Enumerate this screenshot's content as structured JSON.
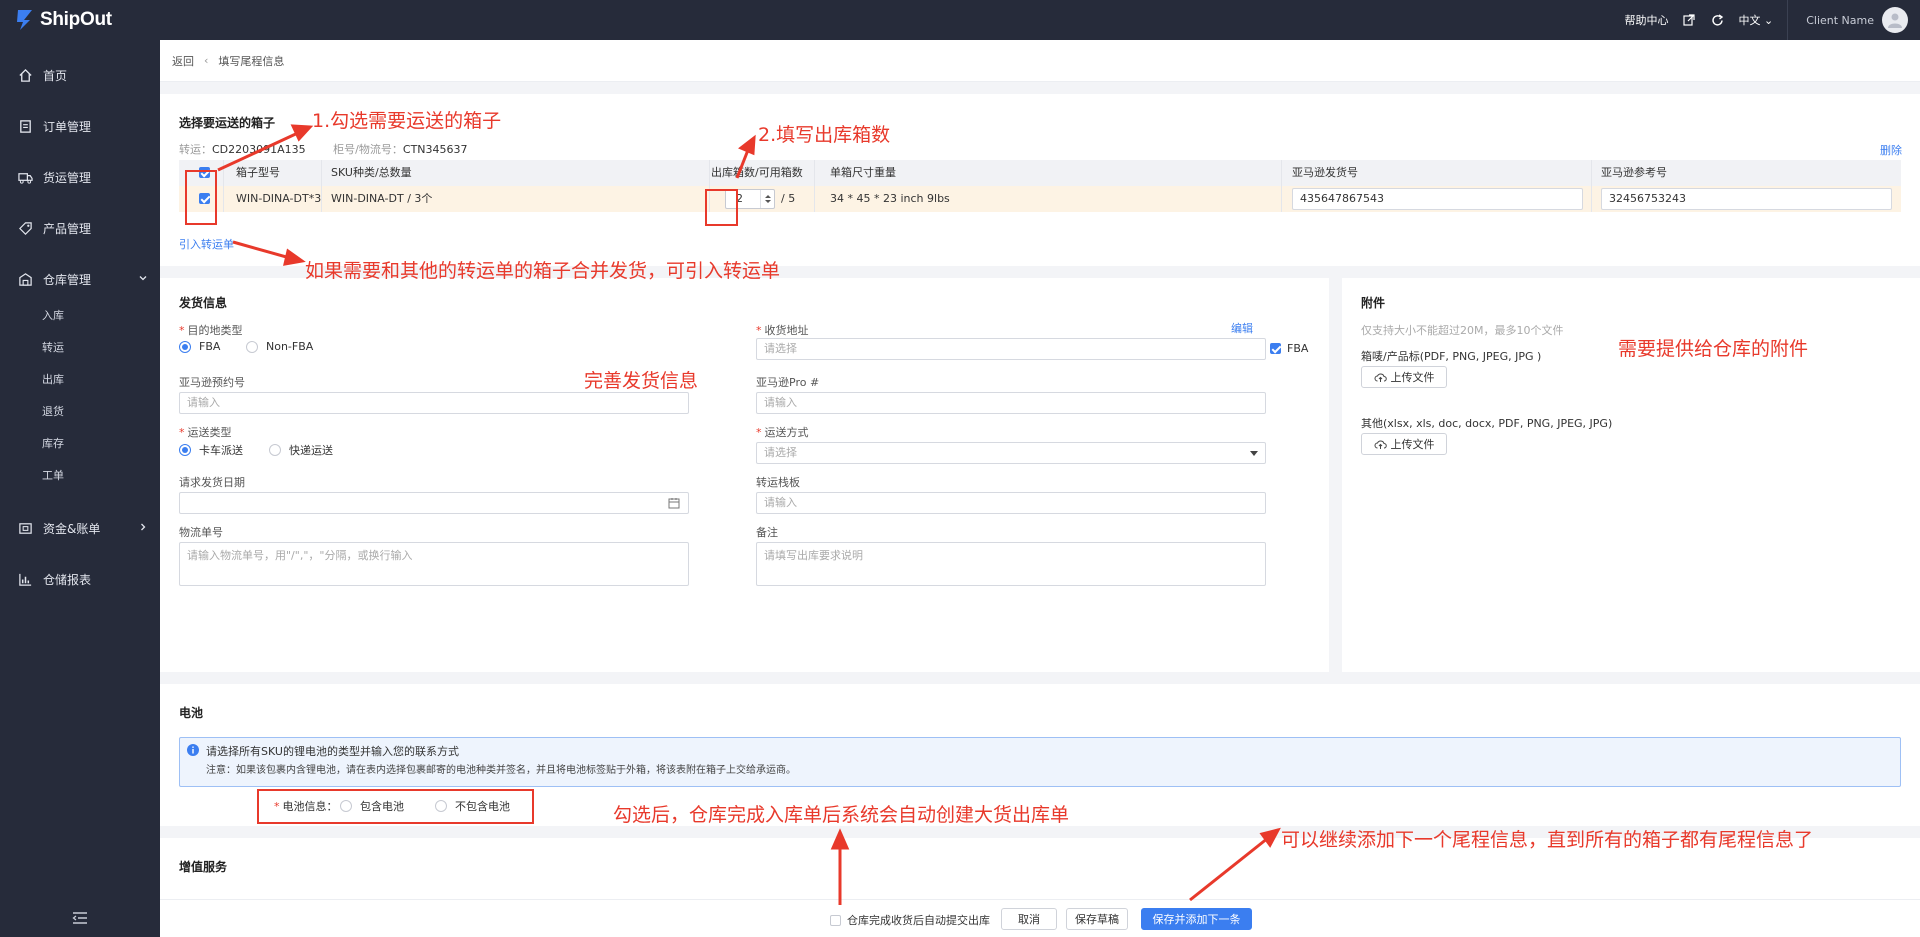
{
  "header": {
    "brand": "ShipOut",
    "help_center": "帮助中心",
    "language": "中文",
    "client_name": "Client Name"
  },
  "sidebar": {
    "items": [
      {
        "label": "首页",
        "icon": "home-icon"
      },
      {
        "label": "订单管理",
        "icon": "order-icon"
      },
      {
        "label": "货运管理",
        "icon": "truck-icon"
      },
      {
        "label": "产品管理",
        "icon": "tag-icon"
      },
      {
        "label": "仓库管理",
        "icon": "warehouse-icon"
      },
      {
        "label": "资金&账单",
        "icon": "finance-icon"
      },
      {
        "label": "仓储报表",
        "icon": "report-icon"
      }
    ],
    "warehouse_sub": [
      "入库",
      "转运",
      "出库",
      "退货",
      "库存",
      "工单"
    ]
  },
  "breadcrumb": {
    "back": "返回",
    "current": "填写尾程信息"
  },
  "boxes": {
    "title": "选择要运送的箱子",
    "transfer_label": "转运：",
    "transfer_value": "CD2203091A135",
    "container_label": "柜号/物流号：",
    "container_value": "CTN345637",
    "delete": "删除",
    "import": "引入转运单",
    "columns": [
      "箱子型号",
      "SKU种类/总数量",
      "出库箱数/可用箱数",
      "单箱尺寸重量",
      "亚马逊发货号",
      "亚马逊参考号"
    ],
    "row": {
      "box_type": "WIN-DINA-DT*3",
      "sku": "WIN-DINA-DT / 3个",
      "out_qty": "2",
      "available": "/ 5",
      "size": "34 * 45 * 23 inch 9lbs",
      "shipment_id": "435647867543",
      "ref_id": "32456753243"
    }
  },
  "shipping": {
    "title": "发货信息",
    "dest_type_label": "目的地类型",
    "dest_options": [
      "FBA",
      "Non-FBA"
    ],
    "address_label": "收货地址",
    "edit": "编辑",
    "address_placeholder": "请选择",
    "fba_check": "FBA",
    "appt_label": "亚马逊预约号",
    "appt_placeholder": "请输入",
    "pro_label": "亚马逊Pro #",
    "pro_placeholder": "请输入",
    "ship_type_label": "运送类型",
    "ship_type_options": [
      "卡车派送",
      "快递运送"
    ],
    "ship_method_label": "运送方式",
    "ship_method_placeholder": "请选择",
    "date_label": "请求发货日期",
    "pallet_label": "转运栈板",
    "pallet_placeholder": "请输入",
    "tracking_label": "物流单号",
    "tracking_placeholder": "请输入物流单号，用\"/\",\"，\"分隔，或换行输入",
    "remark_label": "备注",
    "remark_placeholder": "请填写出库要求说明"
  },
  "attachments": {
    "title": "附件",
    "hint": "仅支持大小不能超过20M，最多10个文件",
    "label1": "箱唛/产品标(PDF, PNG, JPEG, JPG )",
    "label2": "其他(xlsx, xls, doc, docx, PDF, PNG, JPEG, JPG)",
    "upload": "上传文件"
  },
  "battery": {
    "title": "电池",
    "notice1": "请选择所有SKU的锂电池的类型并输入您的联系方式",
    "notice2": "注意：如果该包裹内含锂电池，请在表内选择包裹邮寄的电池种类并签名，并且将电池标签贴于外箱，将该表附在箱子上交给承运商。",
    "info_label": "电池信息：",
    "options": [
      "包含电池",
      "不包含电池"
    ]
  },
  "value_added": {
    "title": "增值服务"
  },
  "footer": {
    "auto_submit": "仓库完成收货后自动提交出库",
    "cancel": "取消",
    "save_draft": "保存草稿",
    "save_add": "保存并添加下一条"
  },
  "annotations": {
    "a1": "1.勾选需要运送的箱子",
    "a2": "2.填写出库箱数",
    "a3": "如果需要和其他的转运单的箱子合并发货，可引入转运单",
    "a4": "完善发货信息",
    "a5": "需要提供给仓库的附件",
    "a6": "勾选后，仓库完成入库单后系统会自动创建大货出库单",
    "a7": "可以继续添加下一个尾程信息，直到所有的箱子都有尾程信息了"
  },
  "colors": {
    "accent": "#3b7ef0",
    "annotation": "#e8392b",
    "sidebar": "#262b3a"
  }
}
